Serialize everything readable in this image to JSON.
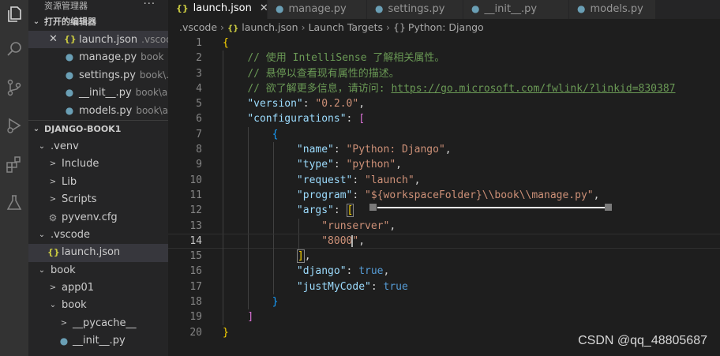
{
  "explorer": {
    "title": "资源管理器",
    "more": "···",
    "open_editors_label": "打开的编辑器",
    "open_editors": [
      {
        "name": "launch.json",
        "desc": ".vscode",
        "icon": "json"
      },
      {
        "name": "manage.py",
        "desc": "book",
        "icon": "python"
      },
      {
        "name": "settings.py",
        "desc": "book\\...",
        "icon": "python"
      },
      {
        "name": "__init__.py",
        "desc": "book\\a...",
        "icon": "python"
      },
      {
        "name": "models.py",
        "desc": "book\\a...",
        "icon": "python"
      }
    ],
    "project_label": "DJANGO-BOOK1",
    "tree": [
      {
        "name": ".venv",
        "indent": 1,
        "kind": "folder-open"
      },
      {
        "name": "Include",
        "indent": 2,
        "kind": "folder"
      },
      {
        "name": "Lib",
        "indent": 2,
        "kind": "folder"
      },
      {
        "name": "Scripts",
        "indent": 2,
        "kind": "folder"
      },
      {
        "name": "pyvenv.cfg",
        "indent": 2,
        "kind": "cfg"
      },
      {
        "name": ".vscode",
        "indent": 1,
        "kind": "folder-open"
      },
      {
        "name": "launch.json",
        "indent": 2,
        "kind": "json"
      },
      {
        "name": "book",
        "indent": 1,
        "kind": "folder-open"
      },
      {
        "name": "app01",
        "indent": 2,
        "kind": "folder"
      },
      {
        "name": "book",
        "indent": 2,
        "kind": "folder-open"
      },
      {
        "name": "__pycache__",
        "indent": 3,
        "kind": "folder"
      },
      {
        "name": "__init__.py",
        "indent": 3,
        "kind": "python"
      }
    ]
  },
  "tabs": [
    {
      "name": "launch.json",
      "icon": "json",
      "active": true,
      "close": "✕"
    },
    {
      "name": "manage.py",
      "icon": "python",
      "active": false
    },
    {
      "name": "settings.py",
      "icon": "python",
      "active": false
    },
    {
      "name": "__init__.py",
      "icon": "python",
      "active": false
    },
    {
      "name": "models.py",
      "icon": "python",
      "active": false
    }
  ],
  "breadcrumb": [
    ".vscode",
    "launch.json",
    "Launch Targets",
    "Python: Django"
  ],
  "code": {
    "line_numbers": [
      "1",
      "2",
      "3",
      "4",
      "5",
      "6",
      "7",
      "8",
      "9",
      "10",
      "11",
      "12",
      "13",
      "14",
      "15",
      "16",
      "17",
      "18",
      "19",
      "20"
    ],
    "current_line": "14",
    "l1": "{",
    "l2": "// 使用 IntelliSense 了解相关属性。",
    "l3": "// 悬停以查看现有属性的描述。",
    "l4_prefix": "// 欲了解更多信息，请访问: ",
    "l4_link": "https://go.microsoft.com/fwlink/?linkid=830387",
    "k_version": "\"version\"",
    "v_version": "\"0.2.0\"",
    "k_configurations": "\"configurations\"",
    "k_name": "\"name\"",
    "v_name": "\"Python: Django\"",
    "k_type": "\"type\"",
    "v_type": "\"python\"",
    "k_request": "\"request\"",
    "v_request": "\"launch\"",
    "k_program": "\"program\"",
    "v_program": "\"${workspaceFolder}\\\\book\\\\manage.py\"",
    "k_args": "\"args\"",
    "v_runserver": "\"runserver\"",
    "v_port_a": "\"8000",
    "v_port_b": "\"",
    "k_django": "\"django\"",
    "v_true": "true",
    "k_justmycode": "\"justMyCode\""
  },
  "watermark": "CSDN @qq_48805687"
}
